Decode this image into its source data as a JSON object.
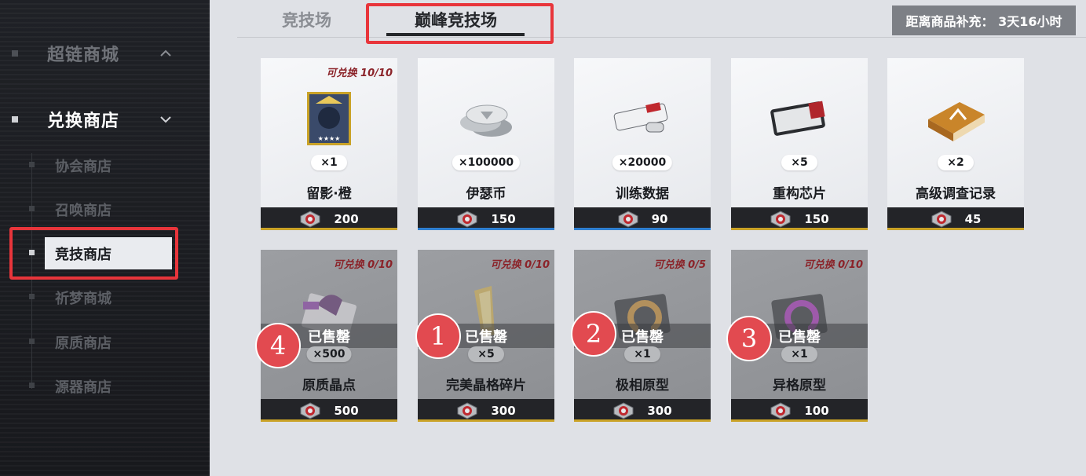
{
  "sidebar": {
    "groups": [
      {
        "label": "超链商城"
      },
      {
        "label": "兑换商店"
      }
    ],
    "items": [
      {
        "label": "协会商店"
      },
      {
        "label": "召唤商店"
      },
      {
        "label": "竞技商店"
      },
      {
        "label": "祈梦商城"
      },
      {
        "label": "原质商店"
      },
      {
        "label": "源器商店"
      }
    ]
  },
  "tabs": [
    {
      "label": "竞技场"
    },
    {
      "label": "巅峰竞技场"
    }
  ],
  "countdown": "距离商品补充： 3天16小时",
  "currency_icon": "arena-medal-icon",
  "cards": [
    {
      "stock": "可兑换 10/10",
      "qty": "×1",
      "name": "留影·橙",
      "price": "200",
      "accent": "#c9a227",
      "sold": false
    },
    {
      "stock": "",
      "qty": "×100000",
      "name": "伊瑟币",
      "price": "150",
      "accent": "#2f7fd1",
      "sold": false
    },
    {
      "stock": "",
      "qty": "×20000",
      "name": "训练数据",
      "price": "90",
      "accent": "#2f7fd1",
      "sold": false
    },
    {
      "stock": "",
      "qty": "×5",
      "name": "重构芯片",
      "price": "150",
      "accent": "#c9a227",
      "sold": false
    },
    {
      "stock": "",
      "qty": "×2",
      "name": "高级调查记录",
      "price": "45",
      "accent": "#c9a227",
      "sold": false
    },
    {
      "stock": "可兑换 0/10",
      "qty": "×500",
      "name": "原质晶点",
      "price": "500",
      "accent": "#c9a227",
      "sold": true,
      "sold_label": "已售罄"
    },
    {
      "stock": "可兑换 0/10",
      "qty": "×5",
      "name": "完美晶格碎片",
      "price": "300",
      "accent": "#c9a227",
      "sold": true,
      "sold_label": "已售罄"
    },
    {
      "stock": "可兑换 0/5",
      "qty": "×1",
      "name": "极相原型",
      "price": "300",
      "accent": "#c9a227",
      "sold": true,
      "sold_label": "已售罄"
    },
    {
      "stock": "可兑换 0/10",
      "qty": "×1",
      "name": "异格原型",
      "price": "100",
      "accent": "#c9a227",
      "sold": true,
      "sold_label": "已售罄"
    }
  ],
  "badges": [
    "4",
    "1",
    "2",
    "3"
  ]
}
